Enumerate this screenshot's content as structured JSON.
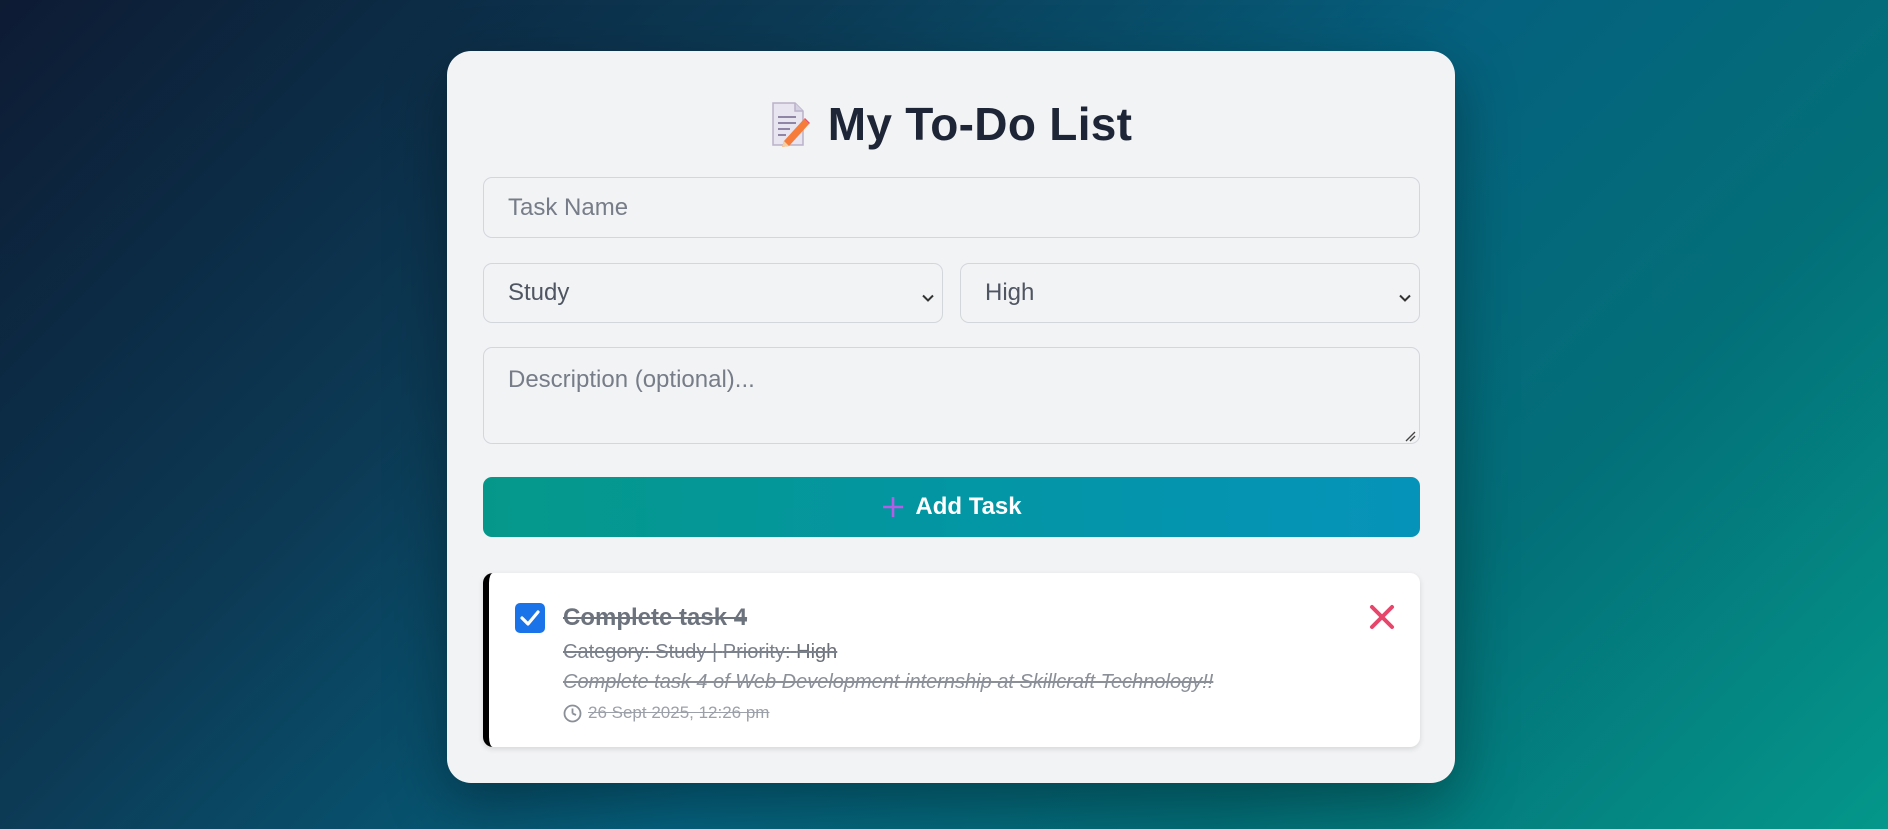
{
  "header": {
    "title": "My To-Do List",
    "title_icon": "memo-pencil-icon"
  },
  "form": {
    "task_name_placeholder": "Task Name",
    "task_name_value": "",
    "category_selected": "Study",
    "priority_selected": "High",
    "description_placeholder": "Description (optional)...",
    "description_value": "",
    "add_button_label": "Add Task",
    "add_button_icon": "plus-icon"
  },
  "tasks": [
    {
      "completed": true,
      "name": "Complete task 4",
      "category_label": "Category:",
      "category": "Study",
      "separator": "|",
      "priority_label": "Priority:",
      "priority": "High",
      "description": "Complete task 4 of Web Development internship at Skillcraft Technology!!",
      "timestamp": "26 Sept 2025, 12:26 pm",
      "delete_icon": "close-icon"
    }
  ],
  "colors": {
    "accent_blue": "#1a73e8",
    "delete_pink": "#e8456b",
    "button_gradient_start": "#05988a",
    "button_gradient_end": "#0693ba",
    "plus_purple": "#b65ce6"
  }
}
